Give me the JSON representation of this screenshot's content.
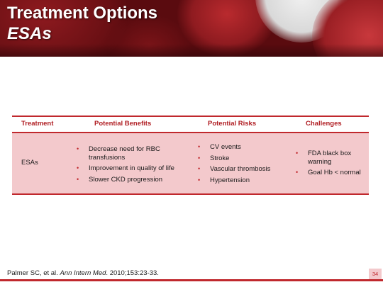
{
  "slide": {
    "title": "Treatment Options",
    "subtitle": "ESAs",
    "page_number": "34"
  },
  "table": {
    "headers": [
      "Treatment",
      "Potential Benefits",
      "Potential Risks",
      "Challenges"
    ],
    "row": {
      "treatment": "ESAs",
      "benefits": [
        "Decrease need for RBC transfusions",
        "Improvement in quality of life",
        "Slower CKD progression"
      ],
      "risks": [
        "CV events",
        "Stroke",
        "Vascular thrombosis",
        "Hypertension"
      ],
      "challenges": [
        "FDA black box warning",
        "Goal Hb < normal"
      ]
    }
  },
  "citation": {
    "authors": "Palmer SC, et al. ",
    "journal": "Ann Intern Med",
    "details": ". 2010;153:23-33."
  },
  "colors": {
    "accent": "#c0282d",
    "row_fill": "#f3c9cc",
    "banner": "#5a0b0f"
  }
}
